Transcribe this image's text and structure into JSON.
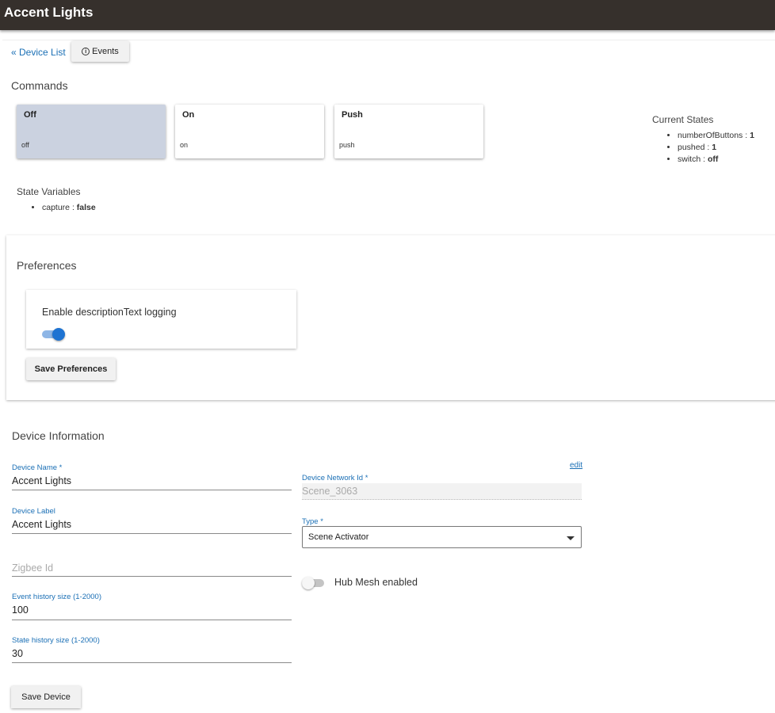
{
  "header": {
    "title": "Accent Lights"
  },
  "nav": {
    "back_link": "« Device List",
    "events_button": "Events"
  },
  "commands": {
    "title": "Commands",
    "items": [
      {
        "label": "Off",
        "sub": "off",
        "active": true
      },
      {
        "label": "On",
        "sub": "on",
        "active": false
      },
      {
        "label": "Push",
        "sub": "push",
        "active": false
      }
    ]
  },
  "current_states": {
    "title": "Current States",
    "items": [
      {
        "key": "numberOfButtons",
        "value": "1"
      },
      {
        "key": "pushed",
        "value": "1"
      },
      {
        "key": "switch",
        "value": "off"
      }
    ]
  },
  "state_variables": {
    "title": "State Variables",
    "items": [
      {
        "key": "capture",
        "value": "false"
      }
    ]
  },
  "preferences": {
    "title": "Preferences",
    "logging_label": "Enable descriptionText logging",
    "logging_enabled": true,
    "save_label": "Save Preferences"
  },
  "device_info": {
    "title": "Device Information",
    "device_name_label": "Device Name *",
    "device_name": "Accent Lights",
    "device_label_label": "Device Label",
    "device_label": "Accent Lights",
    "zigbee_placeholder": "Zigbee Id",
    "event_history_label": "Event history size (1-2000)",
    "event_history": "100",
    "state_history_label": "State history size (1-2000)",
    "state_history": "30",
    "edit_link": "edit",
    "network_id_label": "Device Network Id *",
    "network_id": "Scene_3063",
    "type_label": "Type *",
    "type_value": "Scene Activator",
    "hub_mesh_label": "Hub Mesh enabled",
    "hub_mesh_enabled": false,
    "save_label": "Save Device"
  },
  "colors": {
    "header_bg": "#36302c",
    "accent": "#1a6fb5",
    "active_command": "#cbd2e0"
  },
  "icons": {
    "events": "info-circle-icon",
    "type_dropdown": "caret-down-icon"
  }
}
